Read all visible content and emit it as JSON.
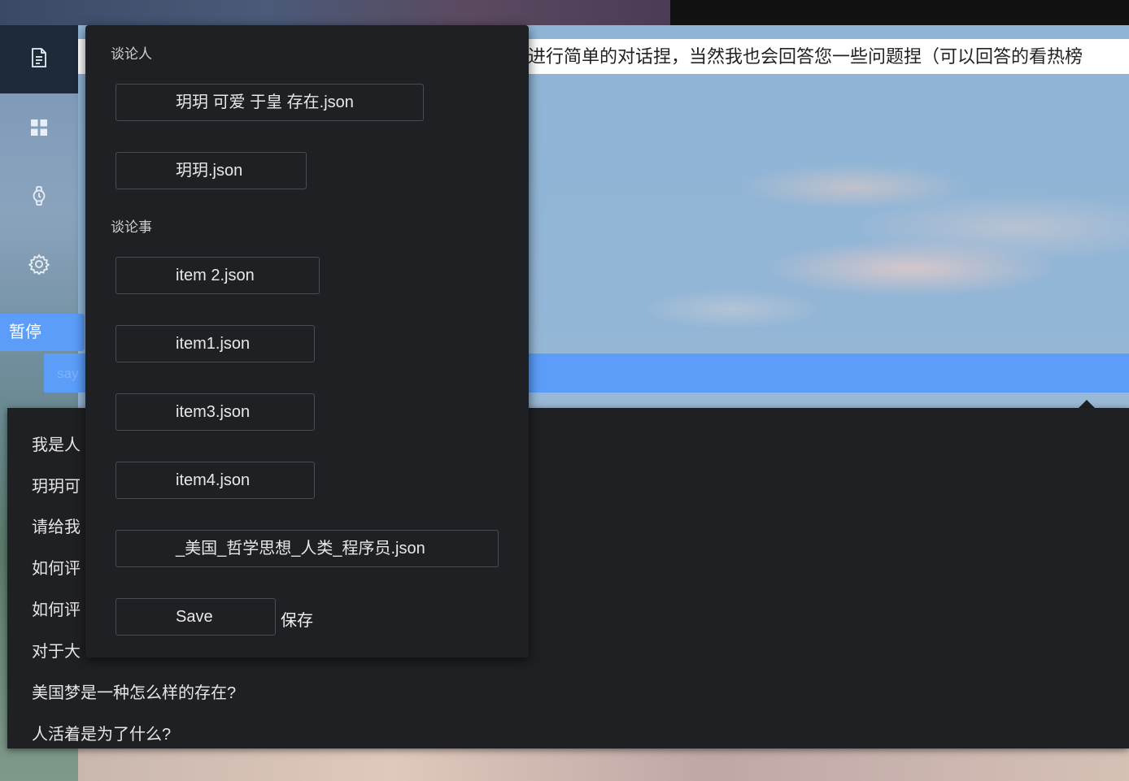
{
  "sidebar": {
    "icons": [
      "document-icon",
      "grid-icon",
      "watch-icon",
      "gear-icon"
    ],
    "pause_label": "暂停"
  },
  "chat": {
    "intro_text": "进行简单的对话捏，当然我也会回答您一些问题捏（可以回答的看热榜",
    "input_placeholder": "say"
  },
  "suggestions": [
    "我是人",
    "玥玥可",
    "请给我",
    "如何评",
    "如何评",
    "对于大",
    "美国梦是一种怎么样的存在?",
    "人活着是为了什么?"
  ],
  "panel": {
    "people_label": "谈论人",
    "people_files": [
      "玥玥 可爱 于皇 存在.json",
      "玥玥.json"
    ],
    "topics_label": "谈论事",
    "topic_files": [
      "item 2.json",
      "item1.json",
      "item3.json",
      "item4.json",
      "_美国_哲学思想_人类_程序员.json"
    ],
    "save_button": "Save",
    "save_note": "保存"
  },
  "colors": {
    "accent": "#5b9df9",
    "panel_bg": "#1f2023",
    "button_border": "#4a4c52"
  }
}
